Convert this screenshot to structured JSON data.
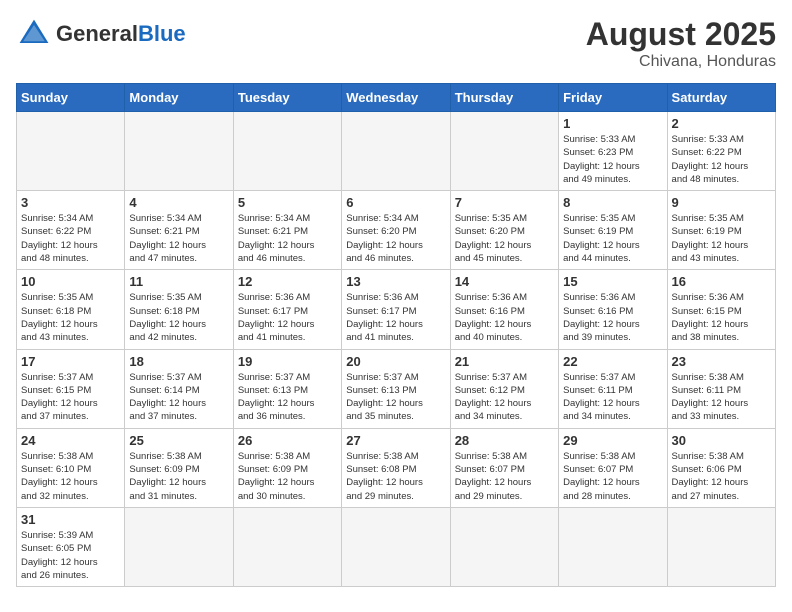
{
  "header": {
    "logo_general": "General",
    "logo_blue": "Blue",
    "month_year": "August 2025",
    "location": "Chivana, Honduras"
  },
  "weekdays": [
    "Sunday",
    "Monday",
    "Tuesday",
    "Wednesday",
    "Thursday",
    "Friday",
    "Saturday"
  ],
  "weeks": [
    [
      {
        "day": "",
        "info": ""
      },
      {
        "day": "",
        "info": ""
      },
      {
        "day": "",
        "info": ""
      },
      {
        "day": "",
        "info": ""
      },
      {
        "day": "",
        "info": ""
      },
      {
        "day": "1",
        "info": "Sunrise: 5:33 AM\nSunset: 6:23 PM\nDaylight: 12 hours\nand 49 minutes."
      },
      {
        "day": "2",
        "info": "Sunrise: 5:33 AM\nSunset: 6:22 PM\nDaylight: 12 hours\nand 48 minutes."
      }
    ],
    [
      {
        "day": "3",
        "info": "Sunrise: 5:34 AM\nSunset: 6:22 PM\nDaylight: 12 hours\nand 48 minutes."
      },
      {
        "day": "4",
        "info": "Sunrise: 5:34 AM\nSunset: 6:21 PM\nDaylight: 12 hours\nand 47 minutes."
      },
      {
        "day": "5",
        "info": "Sunrise: 5:34 AM\nSunset: 6:21 PM\nDaylight: 12 hours\nand 46 minutes."
      },
      {
        "day": "6",
        "info": "Sunrise: 5:34 AM\nSunset: 6:20 PM\nDaylight: 12 hours\nand 46 minutes."
      },
      {
        "day": "7",
        "info": "Sunrise: 5:35 AM\nSunset: 6:20 PM\nDaylight: 12 hours\nand 45 minutes."
      },
      {
        "day": "8",
        "info": "Sunrise: 5:35 AM\nSunset: 6:19 PM\nDaylight: 12 hours\nand 44 minutes."
      },
      {
        "day": "9",
        "info": "Sunrise: 5:35 AM\nSunset: 6:19 PM\nDaylight: 12 hours\nand 43 minutes."
      }
    ],
    [
      {
        "day": "10",
        "info": "Sunrise: 5:35 AM\nSunset: 6:18 PM\nDaylight: 12 hours\nand 43 minutes."
      },
      {
        "day": "11",
        "info": "Sunrise: 5:35 AM\nSunset: 6:18 PM\nDaylight: 12 hours\nand 42 minutes."
      },
      {
        "day": "12",
        "info": "Sunrise: 5:36 AM\nSunset: 6:17 PM\nDaylight: 12 hours\nand 41 minutes."
      },
      {
        "day": "13",
        "info": "Sunrise: 5:36 AM\nSunset: 6:17 PM\nDaylight: 12 hours\nand 41 minutes."
      },
      {
        "day": "14",
        "info": "Sunrise: 5:36 AM\nSunset: 6:16 PM\nDaylight: 12 hours\nand 40 minutes."
      },
      {
        "day": "15",
        "info": "Sunrise: 5:36 AM\nSunset: 6:16 PM\nDaylight: 12 hours\nand 39 minutes."
      },
      {
        "day": "16",
        "info": "Sunrise: 5:36 AM\nSunset: 6:15 PM\nDaylight: 12 hours\nand 38 minutes."
      }
    ],
    [
      {
        "day": "17",
        "info": "Sunrise: 5:37 AM\nSunset: 6:15 PM\nDaylight: 12 hours\nand 37 minutes."
      },
      {
        "day": "18",
        "info": "Sunrise: 5:37 AM\nSunset: 6:14 PM\nDaylight: 12 hours\nand 37 minutes."
      },
      {
        "day": "19",
        "info": "Sunrise: 5:37 AM\nSunset: 6:13 PM\nDaylight: 12 hours\nand 36 minutes."
      },
      {
        "day": "20",
        "info": "Sunrise: 5:37 AM\nSunset: 6:13 PM\nDaylight: 12 hours\nand 35 minutes."
      },
      {
        "day": "21",
        "info": "Sunrise: 5:37 AM\nSunset: 6:12 PM\nDaylight: 12 hours\nand 34 minutes."
      },
      {
        "day": "22",
        "info": "Sunrise: 5:37 AM\nSunset: 6:11 PM\nDaylight: 12 hours\nand 34 minutes."
      },
      {
        "day": "23",
        "info": "Sunrise: 5:38 AM\nSunset: 6:11 PM\nDaylight: 12 hours\nand 33 minutes."
      }
    ],
    [
      {
        "day": "24",
        "info": "Sunrise: 5:38 AM\nSunset: 6:10 PM\nDaylight: 12 hours\nand 32 minutes."
      },
      {
        "day": "25",
        "info": "Sunrise: 5:38 AM\nSunset: 6:09 PM\nDaylight: 12 hours\nand 31 minutes."
      },
      {
        "day": "26",
        "info": "Sunrise: 5:38 AM\nSunset: 6:09 PM\nDaylight: 12 hours\nand 30 minutes."
      },
      {
        "day": "27",
        "info": "Sunrise: 5:38 AM\nSunset: 6:08 PM\nDaylight: 12 hours\nand 29 minutes."
      },
      {
        "day": "28",
        "info": "Sunrise: 5:38 AM\nSunset: 6:07 PM\nDaylight: 12 hours\nand 29 minutes."
      },
      {
        "day": "29",
        "info": "Sunrise: 5:38 AM\nSunset: 6:07 PM\nDaylight: 12 hours\nand 28 minutes."
      },
      {
        "day": "30",
        "info": "Sunrise: 5:38 AM\nSunset: 6:06 PM\nDaylight: 12 hours\nand 27 minutes."
      }
    ],
    [
      {
        "day": "31",
        "info": "Sunrise: 5:39 AM\nSunset: 6:05 PM\nDaylight: 12 hours\nand 26 minutes."
      },
      {
        "day": "",
        "info": ""
      },
      {
        "day": "",
        "info": ""
      },
      {
        "day": "",
        "info": ""
      },
      {
        "day": "",
        "info": ""
      },
      {
        "day": "",
        "info": ""
      },
      {
        "day": "",
        "info": ""
      }
    ]
  ]
}
